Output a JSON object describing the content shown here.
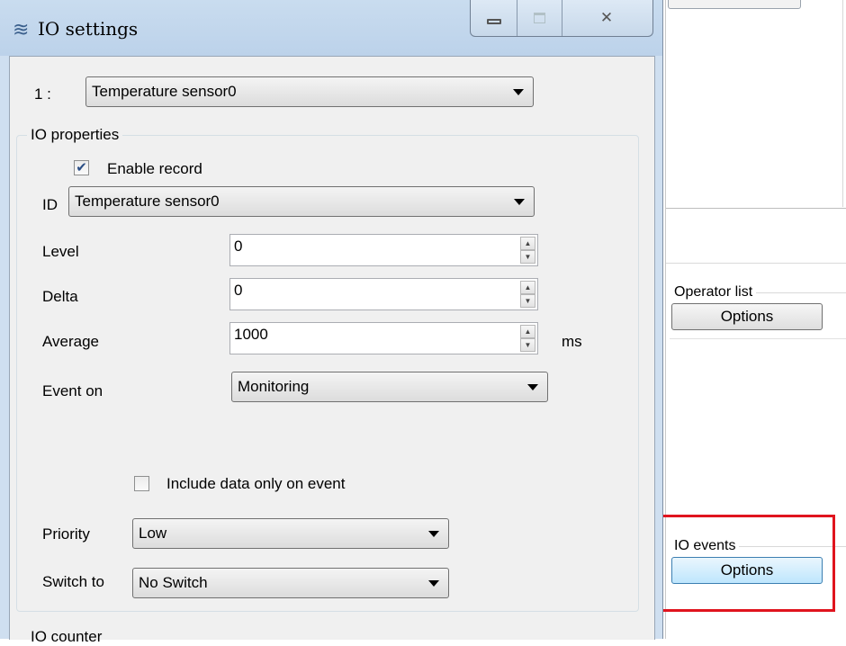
{
  "dialog": {
    "title": "IO settings",
    "title_icon": "wavy-lines-icon",
    "controls": [
      "minimize-icon",
      "maximize-icon",
      "close-icon"
    ],
    "selector_prefix": "1  :",
    "selector_value": "Temperature sensor0",
    "io_properties": {
      "legend": "IO properties",
      "enable_record_label": "Enable record",
      "enable_record_checked": true,
      "id_label": "ID",
      "id_value": "Temperature sensor0",
      "level_label": "Level",
      "level_value": "0",
      "delta_label": "Delta",
      "delta_value": "0",
      "average_label": "Average",
      "average_value": "1000",
      "average_unit": "ms",
      "event_on_label": "Event on",
      "event_on_value": "Monitoring",
      "include_data_label": "Include data only on event",
      "include_data_checked": false,
      "priority_label": "Priority",
      "priority_value": "Low",
      "switch_to_label": "Switch to",
      "switch_to_value": "No Switch"
    },
    "next_group_legend": "IO counter"
  },
  "background": {
    "operator_list": {
      "legend": "Operator list",
      "button": "Options"
    },
    "io_events": {
      "legend": "IO events",
      "button": "Options"
    },
    "highlight_color": "#e0141e"
  }
}
